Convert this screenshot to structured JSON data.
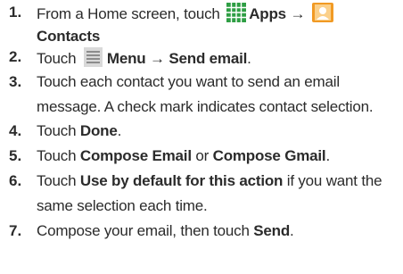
{
  "steps": [
    {
      "number": "1.",
      "pre": "From a Home screen, touch",
      "apps_label": "Apps",
      "arrow": "→",
      "contacts_label": "Contacts",
      "apps_icon": "apps-grid-icon",
      "contacts_icon": "contacts-app-icon"
    },
    {
      "number": "2.",
      "pre": "Touch",
      "menu_label": "Menu",
      "arrow": "→",
      "action": "Send email",
      "post": ".",
      "menu_icon": "menu-icon"
    },
    {
      "number": "3.",
      "line1": "Touch each contact you want to send an email",
      "line2": "message. A check mark indicates contact selection."
    },
    {
      "number": "4.",
      "pre": "Touch",
      "bold": "Done",
      "post": "."
    },
    {
      "number": "5.",
      "pre": "Touch",
      "bold1": "Compose Email",
      "mid": "or",
      "bold2": "Compose Gmail",
      "post": "."
    },
    {
      "number": "6.",
      "pre": "Touch",
      "bold": "Use by default for this action",
      "post": "if you want the",
      "line2": "same selection each time."
    },
    {
      "number": "7.",
      "pre": "Compose your email, then touch",
      "bold": "Send",
      "post": "."
    }
  ],
  "colors": {
    "text": "#2b2b2b",
    "apps_icon": "#2e9e44",
    "contacts_icon": "#f19a24",
    "menu_icon": "#8c8c8c"
  }
}
